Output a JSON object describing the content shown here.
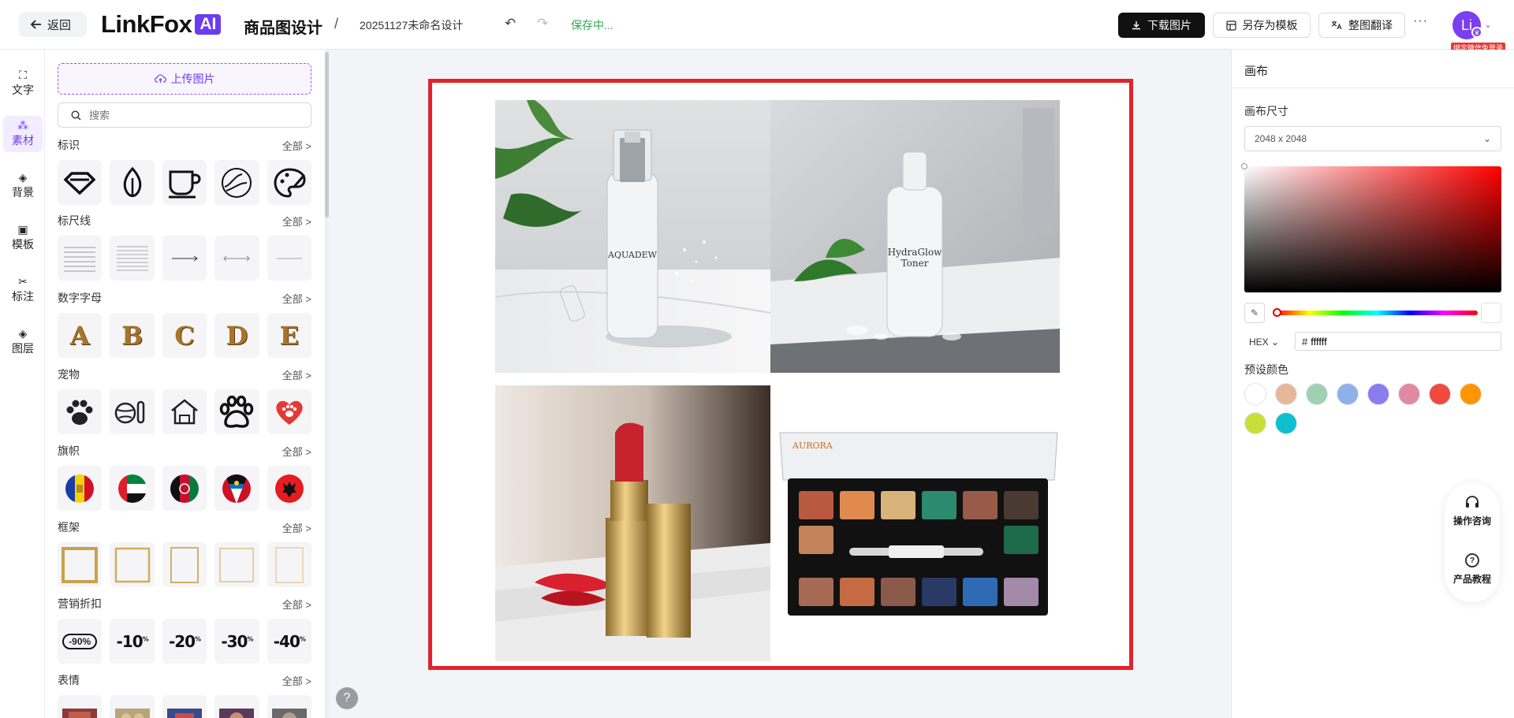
{
  "header": {
    "back_label": "返回",
    "logo_text": "LinkFox",
    "logo_badge": "AI",
    "page_name": "商品图设计",
    "separator": "/",
    "doc_name": "20251127未命名设计",
    "save_status": "保存中...",
    "download_label": "下载图片",
    "save_template_label": "另存为模板",
    "translate_label": "整图翻译",
    "more_label": "···",
    "avatar_text": "Li",
    "bind_tip": "绑定微信免登录"
  },
  "rail": {
    "items": [
      {
        "label": "文字",
        "icon": "text-icon"
      },
      {
        "label": "素材",
        "icon": "shapes-icon"
      },
      {
        "label": "背景",
        "icon": "layers-icon"
      },
      {
        "label": "模板",
        "icon": "template-icon"
      },
      {
        "label": "标注",
        "icon": "annotation-icon"
      },
      {
        "label": "图层",
        "icon": "layer-stack-icon"
      }
    ],
    "active": "素材"
  },
  "assets": {
    "upload_label": "上传图片",
    "search_placeholder": "搜索",
    "all_label": "全部 >",
    "sections": [
      {
        "title": "标识"
      },
      {
        "title": "标尺线"
      },
      {
        "title": "数字字母",
        "letters": [
          "A",
          "B",
          "C",
          "D",
          "E"
        ]
      },
      {
        "title": "宠物"
      },
      {
        "title": "旗帜"
      },
      {
        "title": "框架"
      },
      {
        "title": "营销折扣",
        "discounts": [
          "-90%",
          "-10",
          "-20",
          "-30",
          "-40"
        ],
        "percent": "%"
      },
      {
        "title": "表情"
      }
    ]
  },
  "canvas": {
    "products": {
      "serum_label": "AQUADEW",
      "toner_label_1": "HydraGlow",
      "toner_label_2": "Toner",
      "palette_brand": "AURORA"
    },
    "help_label": "?"
  },
  "right_panel": {
    "title": "画布",
    "size_label": "画布尺寸",
    "size_value": "2048 x 2048",
    "format": "HEX",
    "hex_prefix": "#",
    "hex_value": "ffffff",
    "preset_label": "预设颜色",
    "presets": [
      "#ffffff",
      "#e6b79b",
      "#9fd0b3",
      "#8fb0ea",
      "#8b7cf0",
      "#e08aa2",
      "#f04a3e",
      "#ff9500",
      "#c8df3a",
      "#0fbfcf"
    ]
  },
  "float_bar": {
    "consult_label": "操作咨询",
    "tutorial_label": "产品教程"
  }
}
